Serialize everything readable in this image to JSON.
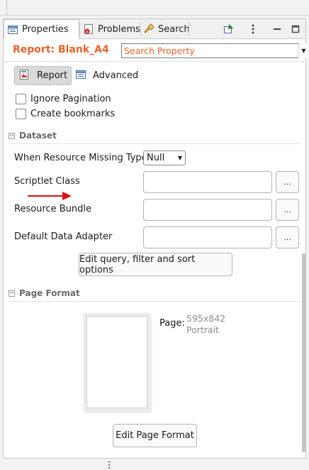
{
  "tabs": [
    {
      "label": "Properties",
      "icon": "properties-icon",
      "active": true
    },
    {
      "label": "Problems",
      "icon": "problems-icon",
      "active": false
    },
    {
      "label": "Search",
      "icon": "search-icon",
      "active": false
    }
  ],
  "toolbar_icons": [
    "pin-icon",
    "view-menu-icon",
    "minimize-icon",
    "maximize-icon"
  ],
  "header": {
    "title": "Report: Blank_A4",
    "search_placeholder": "Search Property"
  },
  "subtabs": {
    "report": "Report",
    "advanced": "Advanced"
  },
  "checkboxes": [
    {
      "label": "Ignore Pagination",
      "checked": false
    },
    {
      "label": "Create bookmarks",
      "checked": false
    }
  ],
  "dataset": {
    "section_title": "Dataset",
    "when_resource_missing_label": "When Resource Missing Type",
    "when_resource_missing_value": "Null",
    "scriptlet_label": "Scriptlet Class",
    "bundle_label": "Resource Bundle",
    "adapter_label": "Default Data Adapter",
    "dots_label": "...",
    "edit_query_button": "Edit query, filter and sort options"
  },
  "page_format": {
    "section_title": "Page Format",
    "page_label": "Page:",
    "page_size": "595x842",
    "orientation": "Portrait",
    "edit_button": "Edit Page Format"
  },
  "colors": {
    "accent": "#e8622a",
    "arrow": "#e01010"
  }
}
